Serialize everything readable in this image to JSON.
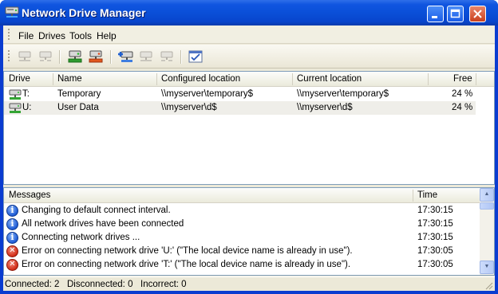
{
  "window": {
    "title": "Network Drive Manager",
    "controls": {
      "minimize": "minimize",
      "maximize": "maximize",
      "close": "close"
    }
  },
  "menu": [
    "File",
    "Drives",
    "Tools",
    "Help"
  ],
  "toolbar": {
    "tools": [
      {
        "name": "connect-drive-icon",
        "enabled": false
      },
      {
        "name": "disconnect-drive-icon",
        "enabled": false
      },
      {
        "name": "connect-all-icon",
        "enabled": true
      },
      {
        "name": "disconnect-all-icon",
        "enabled": true
      },
      {
        "name": "add-drive-icon",
        "enabled": true
      },
      {
        "name": "edit-drive-icon",
        "enabled": false
      },
      {
        "name": "remove-drive-icon",
        "enabled": false
      },
      {
        "name": "check-icon",
        "enabled": true
      }
    ]
  },
  "drives": {
    "columns": [
      "Drive",
      "Name",
      "Configured location",
      "Current location",
      "Free"
    ],
    "rows": [
      {
        "drive": "T:",
        "name": "Temporary",
        "configured": "\\\\myserver\\temporary$",
        "current": "\\\\myserver\\temporary$",
        "free": "24 %"
      },
      {
        "drive": "U:",
        "name": "User Data",
        "configured": "\\\\myserver\\d$",
        "current": "\\\\myserver\\d$",
        "free": "24 %"
      }
    ]
  },
  "messages": {
    "columns": [
      "Messages",
      "Time"
    ],
    "rows": [
      {
        "type": "info",
        "text": "Changing to default connect interval.",
        "time": "17:30:15"
      },
      {
        "type": "info",
        "text": "All network drives have been connected",
        "time": "17:30:15"
      },
      {
        "type": "info",
        "text": "Connecting network drives ...",
        "time": "17:30:15"
      },
      {
        "type": "error",
        "text": "Error on connecting network drive 'U:' (\"The local device name is already in use\").",
        "time": "17:30:05"
      },
      {
        "type": "error",
        "text": "Error on connecting network drive 'T:' (\"The local device name is already in use\").",
        "time": "17:30:05"
      }
    ]
  },
  "status": {
    "text": "Connected: 2   Disconnected: 0   Incorrect: 0"
  }
}
